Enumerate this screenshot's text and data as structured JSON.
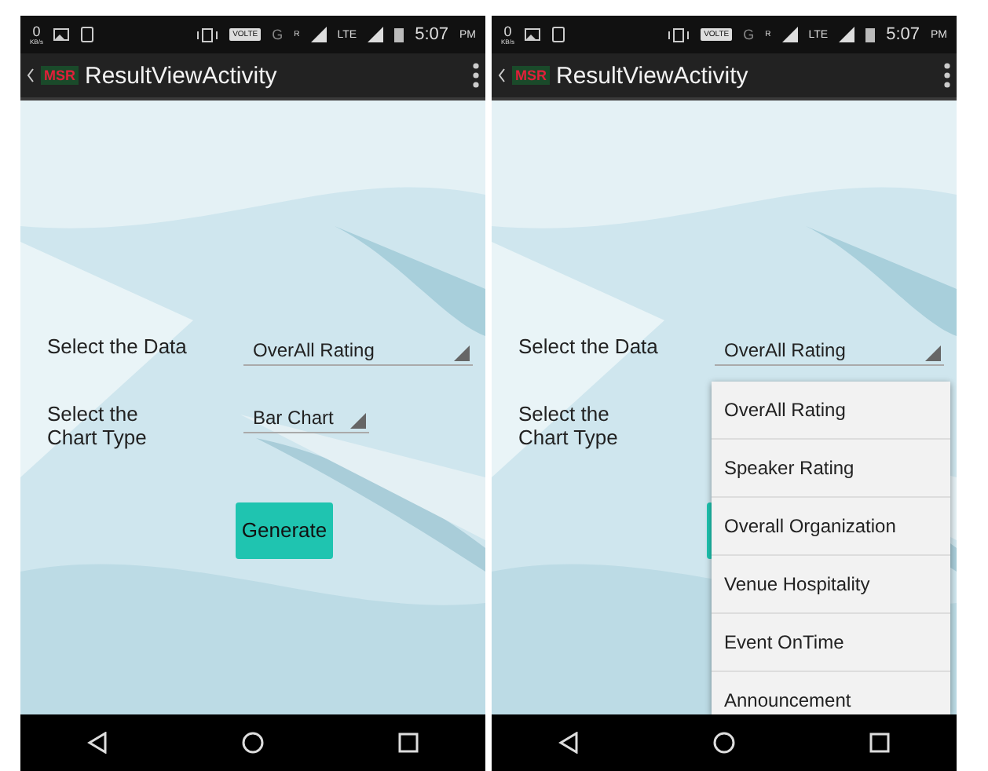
{
  "screens": [
    {
      "status_bar": {
        "speed_value": "0",
        "speed_unit": "KB/s",
        "volte": "VOLTE",
        "network_g": "G",
        "roaming": "R",
        "lte": "LTE",
        "time": "5:07",
        "ampm": "PM"
      },
      "app_bar": {
        "logo": "MSR",
        "title": "ResultViewActivity"
      },
      "form": {
        "data_label": "Select the Data",
        "data_value": "OverAll Rating",
        "chart_label": "Select the\nChart Type",
        "chart_value": "Bar Chart"
      },
      "generate": {
        "label": "Generate",
        "covered": false
      }
    },
    {
      "status_bar": {
        "speed_value": "0",
        "speed_unit": "KB/s",
        "volte": "VOLTE",
        "network_g": "G",
        "roaming": "R",
        "lte": "LTE",
        "time": "5:07",
        "ampm": "PM"
      },
      "app_bar": {
        "logo": "MSR",
        "title": "ResultViewActivity"
      },
      "form": {
        "data_label": "Select the Data",
        "data_value": "OverAll Rating",
        "chart_label": "Select the\nChart Type"
      },
      "generate": {
        "covered": true
      },
      "dropdown": {
        "items": [
          {
            "label": "OverAll Rating"
          },
          {
            "label": "Speaker Rating"
          },
          {
            "label": "Overall Organization"
          },
          {
            "label": "Venue Hospitality"
          },
          {
            "label": "Event OnTime"
          },
          {
            "label": "Announcement"
          }
        ]
      }
    }
  ]
}
